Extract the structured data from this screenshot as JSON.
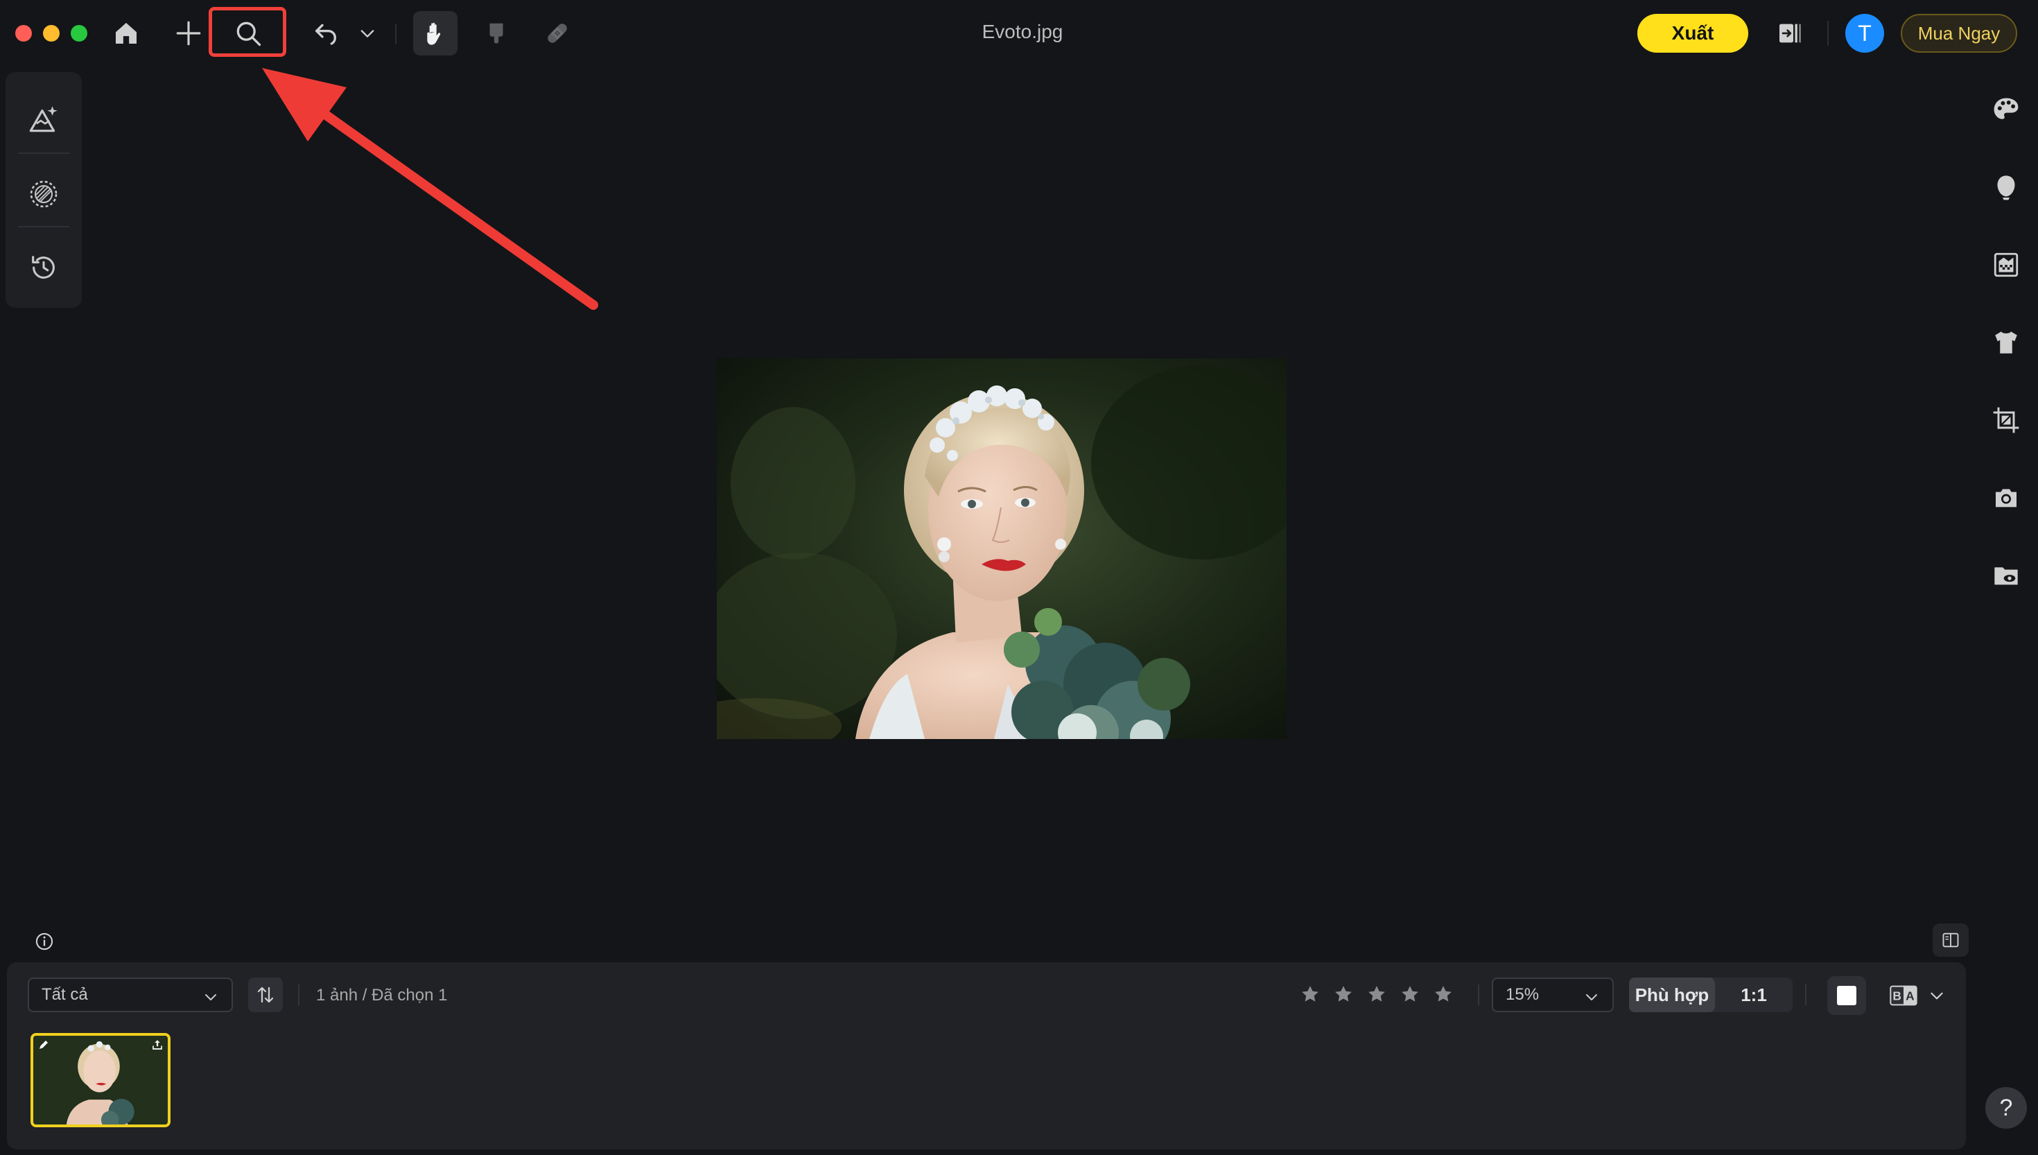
{
  "window": {
    "title": "Evoto.jpg"
  },
  "toolbar": {
    "home_icon": "home-icon",
    "add_icon": "plus-icon",
    "search_icon": "search-icon",
    "undo_icon": "undo-icon",
    "hand_icon": "hand-icon",
    "brush_icon": "brush-icon",
    "patch_icon": "bandage-icon"
  },
  "header_right": {
    "export_label": "Xuất",
    "avatar_initial": "T",
    "buy_label": "Mua Ngay"
  },
  "annotation": {
    "highlight_color": "#f0403a",
    "arrow_color": "#ef3b36"
  },
  "left_tools": [
    {
      "name": "adjust-icon"
    },
    {
      "name": "mask-icon"
    },
    {
      "name": "history-icon"
    }
  ],
  "right_tools": [
    {
      "name": "palette-icon"
    },
    {
      "name": "face-icon"
    },
    {
      "name": "background-icon"
    },
    {
      "name": "clothing-icon"
    },
    {
      "name": "crop-icon"
    },
    {
      "name": "camera-icon"
    },
    {
      "name": "folder-view-icon"
    }
  ],
  "filmstrip": {
    "filter_value": "Tất cả",
    "count_text": "1 ảnh / Đã chọn 1",
    "rating_max": 5,
    "rating_value": 0,
    "zoom_value": "15%",
    "fit_label": "Phù hợp",
    "one_to_one_label": "1:1",
    "ba_label": "BA"
  },
  "help": {
    "label": "?"
  },
  "colors": {
    "accent_yellow": "#ffe01b",
    "avatar_blue": "#1a8cff",
    "thumb_selected": "#f0d020"
  }
}
